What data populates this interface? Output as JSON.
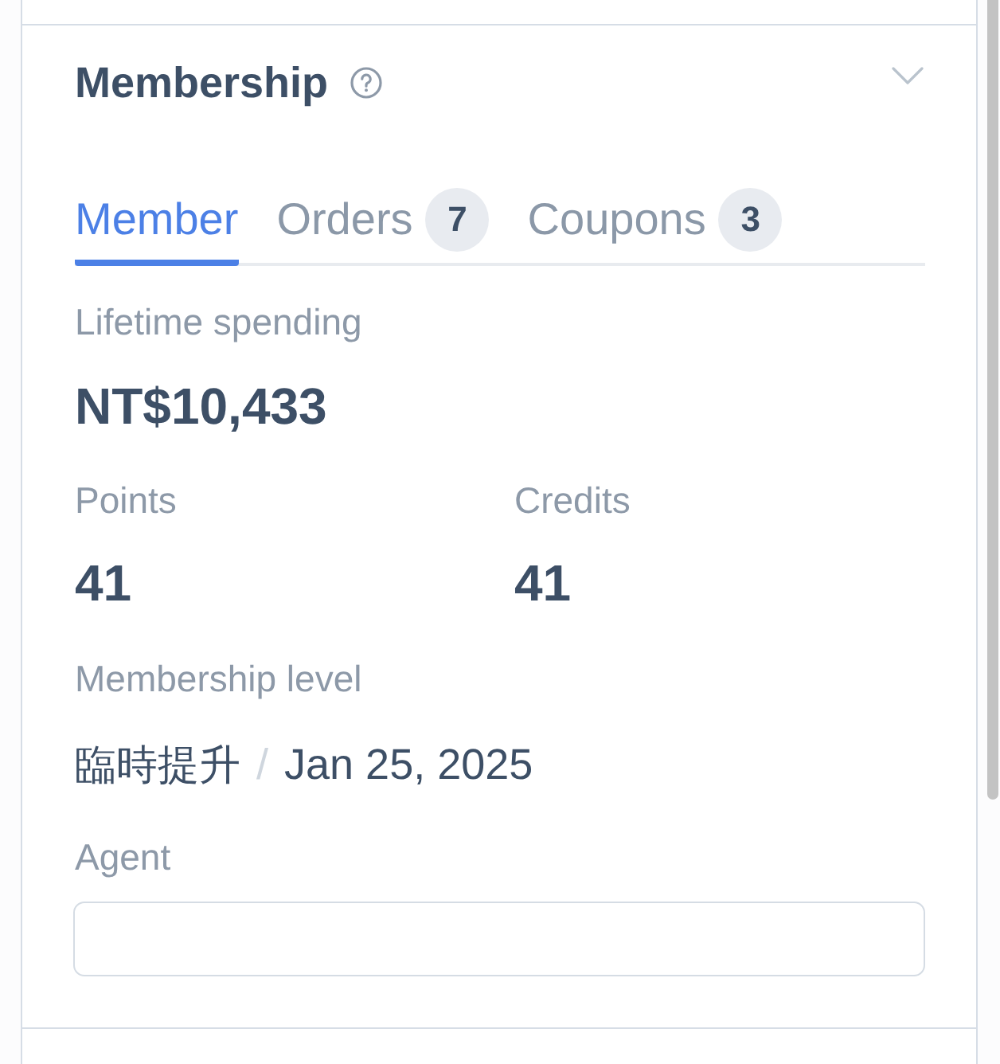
{
  "section": {
    "title": "Membership"
  },
  "tabs": [
    {
      "label": "Member",
      "selected": true
    },
    {
      "label": "Orders",
      "count": "7",
      "selected": false
    },
    {
      "label": "Coupons",
      "count": "3",
      "selected": false
    }
  ],
  "lifetime_spending": {
    "label": "Lifetime spending",
    "value": "NT$10,433"
  },
  "stats": [
    {
      "label": "Points",
      "value": "41"
    },
    {
      "label": "Credits",
      "value": "41"
    }
  ],
  "membership_level": {
    "label": "Membership level",
    "tier": "臨時提升",
    "separator": "/",
    "date": "Jan 25, 2025"
  },
  "agent": {
    "label": "Agent"
  }
}
